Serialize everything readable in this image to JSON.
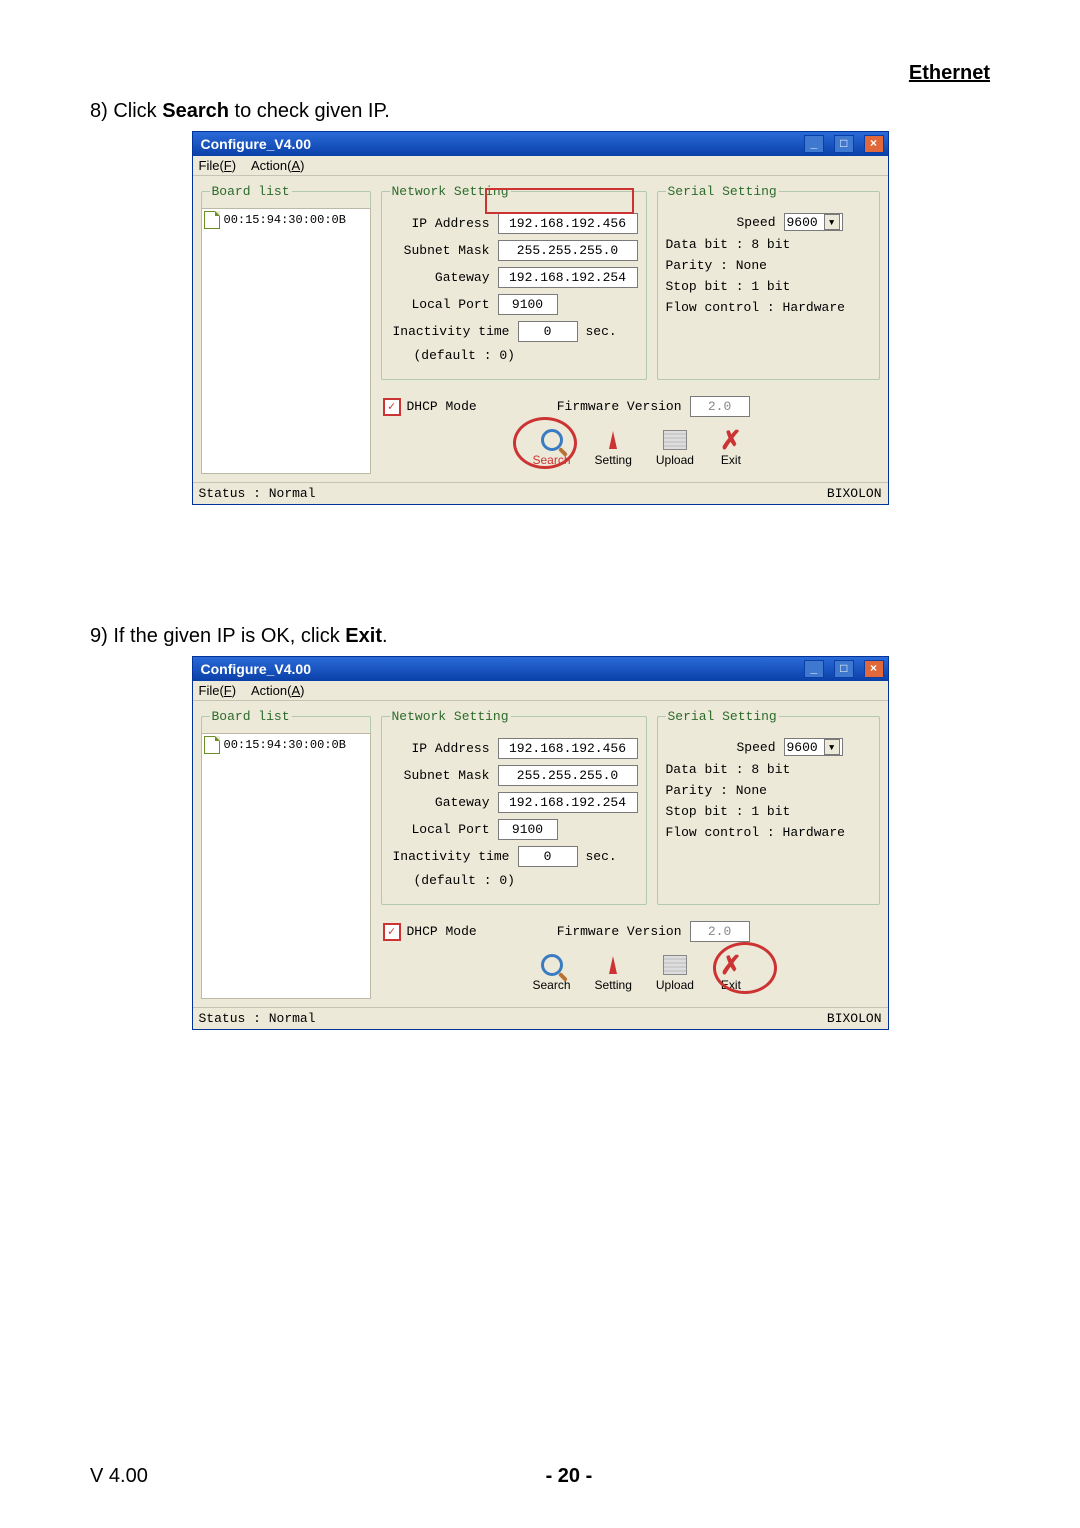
{
  "header": {
    "section": "Ethernet"
  },
  "step8": {
    "text_pre": "8) Click ",
    "text_bold": "Search",
    "text_post": " to check given IP."
  },
  "step9": {
    "text_pre": "9) If the given IP is OK, click ",
    "text_bold": "Exit",
    "text_post": "."
  },
  "win": {
    "title": "Configure_V4.00",
    "menu_file": "File(F)",
    "menu_action": "Action(A)",
    "board_list_legend": "Board list",
    "board_item": "00:15:94:30:00:0B",
    "ns_legend": "Network Setting",
    "ns": {
      "ip_lbl": "IP Address",
      "ip": "192.168.192.456",
      "sm_lbl": "Subnet Mask",
      "sm": "255.255.255.0",
      "gw_lbl": "Gateway",
      "gw": "192.168.192.254",
      "lp_lbl": "Local Port",
      "lp": "9100",
      "it_lbl": "Inactivity time",
      "it": "0",
      "it_unit": "sec.",
      "it_def": "(default : 0)"
    },
    "ss_legend": "Serial Setting",
    "ss": {
      "speed_lbl": "Speed",
      "speed": "9600",
      "db": "Data bit : 8 bit",
      "par": "Parity : None",
      "sb": "Stop bit : 1 bit",
      "fc": "Flow control : Hardware"
    },
    "dhcp": "DHCP Mode",
    "fw_lbl": "Firmware Version",
    "fw": "2.0",
    "btn_search": "Search",
    "btn_setting": "Setting",
    "btn_upload": "Upload",
    "btn_exit": "Exit",
    "status": "Status : Normal",
    "brand": "BIXOLON"
  },
  "footer": {
    "ver": "V 4.00",
    "page": "- 20 -"
  }
}
